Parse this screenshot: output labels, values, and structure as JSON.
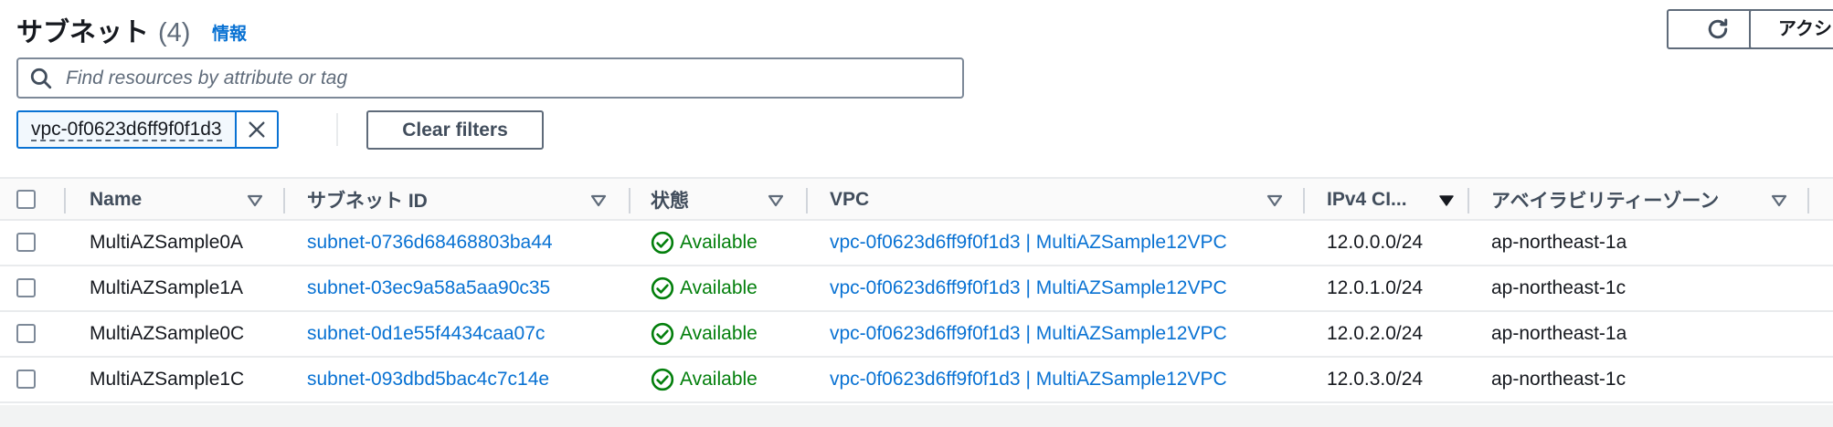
{
  "header": {
    "title": "サブネット",
    "count": "(4)",
    "info_link": "情報",
    "actions_label": "アクシ"
  },
  "search": {
    "placeholder": "Find resources by attribute or tag"
  },
  "filter": {
    "token_label": "vpc-0f0623d6ff9f0f1d3",
    "clear_label": "Clear filters"
  },
  "table": {
    "columns": [
      "Name",
      "サブネット ID",
      "状態",
      "VPC",
      "IPv4 CI...",
      "アベイラビリティーゾーン"
    ],
    "rows": [
      {
        "name": "MultiAZSample0A",
        "subnet_id": "subnet-0736d68468803ba44",
        "state": "Available",
        "vpc": "vpc-0f0623d6ff9f0f1d3 | MultiAZSample12VPC",
        "cidr": "12.0.0.0/24",
        "az": "ap-northeast-1a"
      },
      {
        "name": "MultiAZSample1A",
        "subnet_id": "subnet-03ec9a58a5aa90c35",
        "state": "Available",
        "vpc": "vpc-0f0623d6ff9f0f1d3 | MultiAZSample12VPC",
        "cidr": "12.0.1.0/24",
        "az": "ap-northeast-1c"
      },
      {
        "name": "MultiAZSample0C",
        "subnet_id": "subnet-0d1e55f4434caa07c",
        "state": "Available",
        "vpc": "vpc-0f0623d6ff9f0f1d3 | MultiAZSample12VPC",
        "cidr": "12.0.2.0/24",
        "az": "ap-northeast-1a"
      },
      {
        "name": "MultiAZSample1C",
        "subnet_id": "subnet-093dbd5bac4c7c14e",
        "state": "Available",
        "vpc": "vpc-0f0623d6ff9f0f1d3 | MultiAZSample12VPC",
        "cidr": "12.0.3.0/24",
        "az": "ap-northeast-1c"
      }
    ]
  },
  "colors": {
    "link": "#0972d3",
    "success": "#037f0c",
    "text": "#16191f",
    "header_text": "#414d5c"
  }
}
